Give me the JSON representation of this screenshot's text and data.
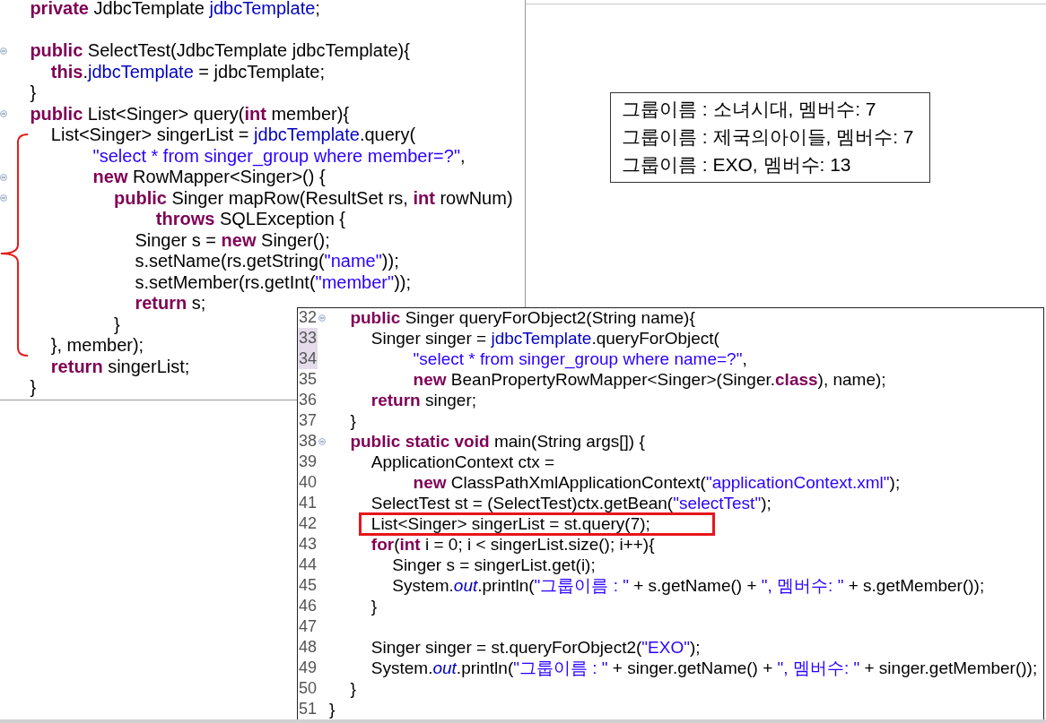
{
  "left_editor": {
    "lines": [
      {
        "fold": false,
        "tokens": [
          {
            "kind": "keyword",
            "text": "\tprivate"
          },
          {
            "kind": "plain",
            "text": " JdbcTemplate "
          },
          {
            "kind": "field",
            "text": "jdbcTemplate"
          },
          {
            "kind": "plain",
            "text": ";"
          }
        ]
      },
      {
        "fold": false
      },
      {
        "fold": true,
        "tokens": [
          {
            "kind": "keyword",
            "text": "\tpublic"
          },
          {
            "kind": "plain",
            "text": " SelectTest(JdbcTemplate jdbcTemplate){"
          }
        ]
      },
      {
        "fold": false,
        "tokens": [
          {
            "kind": "keyword",
            "text": "\t\tthis"
          },
          {
            "kind": "plain",
            "text": "."
          },
          {
            "kind": "field",
            "text": "jdbcTemplate"
          },
          {
            "kind": "plain",
            "text": " = jdbcTemplate;"
          }
        ]
      },
      {
        "fold": false,
        "tokens": [
          {
            "kind": "plain",
            "text": "\t}"
          }
        ]
      },
      {
        "fold": true,
        "tokens": [
          {
            "kind": "keyword",
            "text": "\tpublic"
          },
          {
            "kind": "plain",
            "text": " List<Singer> query("
          },
          {
            "kind": "keyword",
            "text": "int"
          },
          {
            "kind": "plain",
            "text": " member){"
          }
        ]
      },
      {
        "fold": false,
        "tokens": [
          {
            "kind": "plain",
            "text": "\t\tList<Singer> singerList = "
          },
          {
            "kind": "field",
            "text": "jdbcTemplate"
          },
          {
            "kind": "plain",
            "text": ".query("
          }
        ]
      },
      {
        "fold": false,
        "tokens": [
          {
            "kind": "string",
            "text": "\t\t\t\t\"select * from singer_group where member=?\""
          },
          {
            "kind": "plain",
            "text": ","
          }
        ]
      },
      {
        "fold": true,
        "tokens": [
          {
            "kind": "keyword",
            "text": "\t\t\t\tnew"
          },
          {
            "kind": "plain",
            "text": " RowMapper<Singer>() {"
          }
        ]
      },
      {
        "fold": true,
        "tokens": [
          {
            "kind": "keyword",
            "text": "\t\t\t\t\tpublic"
          },
          {
            "kind": "plain",
            "text": " Singer mapRow(ResultSet rs, "
          },
          {
            "kind": "keyword",
            "text": "int"
          },
          {
            "kind": "plain",
            "text": " rowNum)"
          }
        ]
      },
      {
        "fold": false,
        "tokens": [
          {
            "kind": "keyword",
            "text": "\t\t\t\t\t\t\tthrows"
          },
          {
            "kind": "plain",
            "text": " SQLException {"
          }
        ]
      },
      {
        "fold": false,
        "tokens": [
          {
            "kind": "plain",
            "text": "\t\t\t\t\t\tSinger s = "
          },
          {
            "kind": "keyword",
            "text": "new"
          },
          {
            "kind": "plain",
            "text": " Singer();"
          }
        ]
      },
      {
        "fold": false,
        "tokens": [
          {
            "kind": "plain",
            "text": "\t\t\t\t\t\ts.setName(rs.getString("
          },
          {
            "kind": "string",
            "text": "\"name\""
          },
          {
            "kind": "plain",
            "text": "));"
          }
        ]
      },
      {
        "fold": false,
        "tokens": [
          {
            "kind": "plain",
            "text": "\t\t\t\t\t\ts.setMember(rs.getInt("
          },
          {
            "kind": "string",
            "text": "\"member\""
          },
          {
            "kind": "plain",
            "text": "));"
          }
        ]
      },
      {
        "fold": false,
        "tokens": [
          {
            "kind": "keyword",
            "text": "\t\t\t\t\t\treturn"
          },
          {
            "kind": "plain",
            "text": " s;"
          }
        ]
      },
      {
        "fold": false,
        "tokens": [
          {
            "kind": "plain",
            "text": "\t\t\t\t\t}"
          }
        ]
      },
      {
        "fold": false,
        "tokens": [
          {
            "kind": "plain",
            "text": "\t\t}, member);"
          }
        ]
      },
      {
        "fold": false,
        "tokens": [
          {
            "kind": "keyword",
            "text": "\t\treturn"
          },
          {
            "kind": "plain",
            "text": " singerList;"
          }
        ]
      },
      {
        "fold": false,
        "tokens": [
          {
            "kind": "plain",
            "text": "\t}"
          }
        ]
      }
    ]
  },
  "output": {
    "lines": [
      "그룹이름 : 소녀시대, 멤버수: 7",
      "그룹이름 : 제국의아이들, 멤버수: 7",
      "그룹이름 : EXO, 멤버수: 13"
    ]
  },
  "main_editor": {
    "lines": [
      {
        "number": "32",
        "fold": true,
        "marked": false,
        "highlighted": false,
        "tokens": [
          {
            "kind": "keyword",
            "text": "\tpublic"
          },
          {
            "kind": "plain",
            "text": " Singer queryForObject2(String name){"
          }
        ]
      },
      {
        "number": "33",
        "fold": false,
        "marked": true,
        "highlighted": false,
        "tokens": [
          {
            "kind": "plain",
            "text": "\t\tSinger singer = "
          },
          {
            "kind": "field",
            "text": "jdbcTemplate"
          },
          {
            "kind": "plain",
            "text": ".queryForObject("
          }
        ]
      },
      {
        "number": "34",
        "fold": false,
        "marked": true,
        "highlighted": false,
        "tokens": [
          {
            "kind": "string",
            "text": "\t\t\t\t\"select * from singer_group where name=?\""
          },
          {
            "kind": "plain",
            "text": ","
          }
        ]
      },
      {
        "number": "35",
        "fold": false,
        "marked": false,
        "highlighted": false,
        "tokens": [
          {
            "kind": "keyword",
            "text": "\t\t\t\tnew"
          },
          {
            "kind": "plain",
            "text": " BeanPropertyRowMapper<Singer>(Singer."
          },
          {
            "kind": "keyword",
            "text": "class"
          },
          {
            "kind": "plain",
            "text": "), name);"
          }
        ]
      },
      {
        "number": "36",
        "fold": false,
        "marked": false,
        "highlighted": false,
        "tokens": [
          {
            "kind": "keyword",
            "text": "\t\treturn"
          },
          {
            "kind": "plain",
            "text": " singer;"
          }
        ]
      },
      {
        "number": "37",
        "fold": false,
        "marked": false,
        "highlighted": false,
        "tokens": [
          {
            "kind": "plain",
            "text": "\t}"
          }
        ]
      },
      {
        "number": "38",
        "fold": true,
        "marked": false,
        "highlighted": false,
        "tokens": [
          {
            "kind": "keyword",
            "text": "\tpublic static void"
          },
          {
            "kind": "plain",
            "text": " main(String args[]) {"
          }
        ]
      },
      {
        "number": "39",
        "fold": false,
        "marked": false,
        "highlighted": false,
        "tokens": [
          {
            "kind": "plain",
            "text": "\t\tApplicationContext ctx ="
          }
        ]
      },
      {
        "number": "40",
        "fold": false,
        "marked": false,
        "highlighted": false,
        "tokens": [
          {
            "kind": "keyword",
            "text": "\t\t\t\tnew"
          },
          {
            "kind": "plain",
            "text": " ClassPathXmlApplicationContext("
          },
          {
            "kind": "string",
            "text": "\"applicationContext.xml\""
          },
          {
            "kind": "plain",
            "text": ");"
          }
        ]
      },
      {
        "number": "41",
        "fold": false,
        "marked": false,
        "highlighted": false,
        "tokens": [
          {
            "kind": "plain",
            "text": "\t\tSelectTest st = (SelectTest)ctx.getBean("
          },
          {
            "kind": "string",
            "text": "\"selectTest\""
          },
          {
            "kind": "plain",
            "text": ");"
          }
        ]
      },
      {
        "number": "42",
        "fold": false,
        "marked": false,
        "highlighted": true,
        "tokens": [
          {
            "kind": "plain",
            "text": "\t\tList<Singer> singerList = st.query(7);"
          }
        ]
      },
      {
        "number": "43",
        "fold": false,
        "marked": false,
        "highlighted": false,
        "tokens": [
          {
            "kind": "keyword",
            "text": "\t\tfor"
          },
          {
            "kind": "plain",
            "text": "("
          },
          {
            "kind": "keyword",
            "text": "int"
          },
          {
            "kind": "plain",
            "text": " i = 0; i < singerList.size(); i++){"
          }
        ]
      },
      {
        "number": "44",
        "fold": false,
        "marked": false,
        "highlighted": false,
        "tokens": [
          {
            "kind": "plain",
            "text": "\t\t\tSinger s = singerList.get(i);"
          }
        ]
      },
      {
        "number": "45",
        "fold": false,
        "marked": false,
        "highlighted": false,
        "tokens": [
          {
            "kind": "plain",
            "text": "\t\t\tSystem."
          },
          {
            "kind": "static",
            "text": "out"
          },
          {
            "kind": "plain",
            "text": ".println("
          },
          {
            "kind": "string",
            "text": "\"그룹이름 : \""
          },
          {
            "kind": "plain",
            "text": " + s.getName() + "
          },
          {
            "kind": "string",
            "text": "\", 멤버수: \""
          },
          {
            "kind": "plain",
            "text": " + s.getMember());"
          }
        ]
      },
      {
        "number": "46",
        "fold": false,
        "marked": false,
        "highlighted": false,
        "tokens": [
          {
            "kind": "plain",
            "text": "\t\t}"
          }
        ]
      },
      {
        "number": "47",
        "fold": false,
        "marked": false,
        "highlighted": false
      },
      {
        "number": "48",
        "fold": false,
        "marked": false,
        "highlighted": false,
        "tokens": [
          {
            "kind": "plain",
            "text": "\t\tSinger singer = st.queryForObject2("
          },
          {
            "kind": "string",
            "text": "\"EXO\""
          },
          {
            "kind": "plain",
            "text": ");"
          }
        ]
      },
      {
        "number": "49",
        "fold": false,
        "marked": false,
        "highlighted": false,
        "tokens": [
          {
            "kind": "plain",
            "text": "\t\tSystem."
          },
          {
            "kind": "static",
            "text": "out"
          },
          {
            "kind": "plain",
            "text": ".println("
          },
          {
            "kind": "string",
            "text": "\"그룹이름 : \""
          },
          {
            "kind": "plain",
            "text": " + singer.getName() + "
          },
          {
            "kind": "string",
            "text": "\", 멤버수: \""
          },
          {
            "kind": "plain",
            "text": " + singer.getMember());"
          }
        ]
      },
      {
        "number": "50",
        "fold": false,
        "marked": false,
        "highlighted": false,
        "tokens": [
          {
            "kind": "plain",
            "text": "\t}"
          }
        ]
      },
      {
        "number": "51",
        "fold": false,
        "marked": false,
        "highlighted": false,
        "tokens": [
          {
            "kind": "plain",
            "text": "}"
          }
        ]
      }
    ]
  }
}
